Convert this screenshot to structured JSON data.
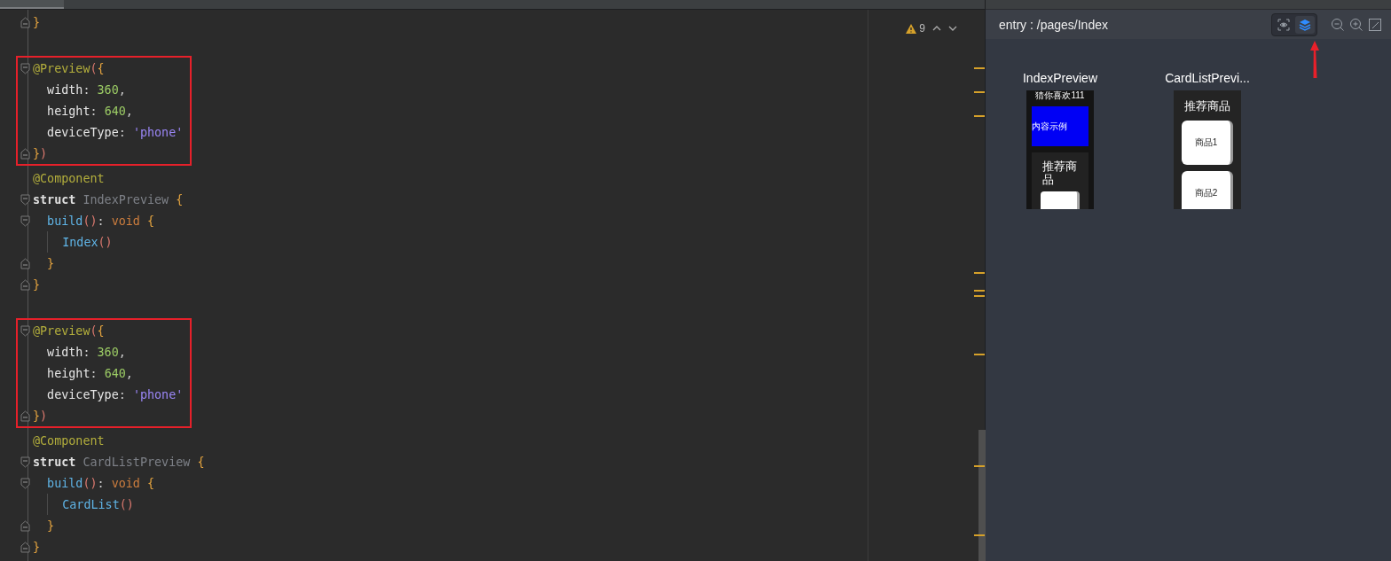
{
  "editor": {
    "warnings": "9",
    "segments": [
      {
        "boxed": false,
        "lines": [
          {
            "kind": "fold_end",
            "tokens": [
              {
                "kind": "brace",
                "text": "}"
              }
            ]
          },
          {
            "kind": "blank"
          }
        ]
      },
      {
        "boxed": true,
        "lines": [
          {
            "kind": "fold_start",
            "tokens": [
              {
                "kind": "annotation",
                "text": "@Preview"
              },
              {
                "kind": "paren",
                "text": "("
              },
              {
                "kind": "brace",
                "text": "{"
              }
            ]
          },
          {
            "kind": "code",
            "tokens": [
              {
                "kind": "key",
                "text": "  width"
              },
              {
                "kind": "plain",
                "text": ": "
              },
              {
                "kind": "number",
                "text": "360"
              },
              {
                "kind": "plain",
                "text": ","
              }
            ]
          },
          {
            "kind": "code",
            "tokens": [
              {
                "kind": "key",
                "text": "  height"
              },
              {
                "kind": "plain",
                "text": ": "
              },
              {
                "kind": "number",
                "text": "640"
              },
              {
                "kind": "plain",
                "text": ","
              }
            ]
          },
          {
            "kind": "code",
            "tokens": [
              {
                "kind": "key",
                "text": "  deviceType"
              },
              {
                "kind": "plain",
                "text": ": "
              },
              {
                "kind": "string",
                "text": "'phone'"
              }
            ]
          },
          {
            "kind": "fold_end",
            "tokens": [
              {
                "kind": "brace",
                "text": "}"
              },
              {
                "kind": "paren",
                "text": ")"
              }
            ]
          }
        ]
      },
      {
        "boxed": false,
        "lines": [
          {
            "kind": "code",
            "tokens": [
              {
                "kind": "annotation",
                "text": "@Component"
              }
            ]
          },
          {
            "kind": "fold_start",
            "tokens": [
              {
                "kind": "keyword",
                "text": "struct "
              },
              {
                "kind": "unused",
                "text": "IndexPreview "
              },
              {
                "kind": "brace",
                "text": "{"
              }
            ]
          },
          {
            "kind": "fold_start",
            "tokens": [
              {
                "kind": "func",
                "text": "  build"
              },
              {
                "kind": "paren",
                "text": "()"
              },
              {
                "kind": "plain",
                "text": ": "
              },
              {
                "kind": "type",
                "text": "void "
              },
              {
                "kind": "brace",
                "text": "{"
              }
            ]
          },
          {
            "kind": "code",
            "guide": true,
            "tokens": [
              {
                "kind": "func",
                "text": "    Index"
              },
              {
                "kind": "paren",
                "text": "()"
              }
            ]
          },
          {
            "kind": "fold_end",
            "tokens": [
              {
                "kind": "brace",
                "text": "  }"
              }
            ]
          },
          {
            "kind": "fold_end",
            "tokens": [
              {
                "kind": "brace",
                "text": "}"
              }
            ]
          },
          {
            "kind": "blank"
          }
        ]
      },
      {
        "boxed": true,
        "lines": [
          {
            "kind": "fold_start",
            "tokens": [
              {
                "kind": "annotation",
                "text": "@Preview"
              },
              {
                "kind": "paren",
                "text": "("
              },
              {
                "kind": "brace",
                "text": "{"
              }
            ]
          },
          {
            "kind": "code",
            "tokens": [
              {
                "kind": "key",
                "text": "  width"
              },
              {
                "kind": "plain",
                "text": ": "
              },
              {
                "kind": "number",
                "text": "360"
              },
              {
                "kind": "plain",
                "text": ","
              }
            ]
          },
          {
            "kind": "code",
            "tokens": [
              {
                "kind": "key",
                "text": "  height"
              },
              {
                "kind": "plain",
                "text": ": "
              },
              {
                "kind": "number",
                "text": "640"
              },
              {
                "kind": "plain",
                "text": ","
              }
            ]
          },
          {
            "kind": "code",
            "tokens": [
              {
                "kind": "key",
                "text": "  deviceType"
              },
              {
                "kind": "plain",
                "text": ": "
              },
              {
                "kind": "string",
                "text": "'phone'"
              }
            ]
          },
          {
            "kind": "fold_end",
            "tokens": [
              {
                "kind": "brace",
                "text": "}"
              },
              {
                "kind": "paren",
                "text": ")"
              }
            ]
          }
        ]
      },
      {
        "boxed": false,
        "lines": [
          {
            "kind": "code",
            "tokens": [
              {
                "kind": "annotation",
                "text": "@Component"
              }
            ]
          },
          {
            "kind": "fold_start",
            "tokens": [
              {
                "kind": "keyword",
                "text": "struct "
              },
              {
                "kind": "unused",
                "text": "CardListPreview "
              },
              {
                "kind": "brace",
                "text": "{"
              }
            ]
          },
          {
            "kind": "fold_start",
            "tokens": [
              {
                "kind": "func",
                "text": "  build"
              },
              {
                "kind": "paren",
                "text": "()"
              },
              {
                "kind": "plain",
                "text": ": "
              },
              {
                "kind": "type",
                "text": "void "
              },
              {
                "kind": "brace",
                "text": "{"
              }
            ]
          },
          {
            "kind": "code",
            "guide": true,
            "tokens": [
              {
                "kind": "func",
                "text": "    CardList"
              },
              {
                "kind": "paren",
                "text": "()"
              }
            ]
          },
          {
            "kind": "fold_end",
            "tokens": [
              {
                "kind": "brace",
                "text": "  }"
              }
            ]
          },
          {
            "kind": "fold_end",
            "tokens": [
              {
                "kind": "brace",
                "text": "}"
              }
            ]
          }
        ]
      }
    ]
  },
  "previewer": {
    "path": "entry : /pages/Index",
    "view_modes": [
      {
        "kind": "inspect",
        "selected": false
      },
      {
        "kind": "layers",
        "selected": true
      }
    ],
    "previews": [
      {
        "title": "IndexPreview",
        "kind": "index",
        "heading": "猜你喜欢111",
        "banner": "内容示例",
        "card_title": "推荐商品"
      },
      {
        "title": "CardListPrevi...",
        "kind": "cardlist",
        "card_title": "推荐商品",
        "items": [
          "商品1",
          "商品2"
        ]
      }
    ]
  }
}
